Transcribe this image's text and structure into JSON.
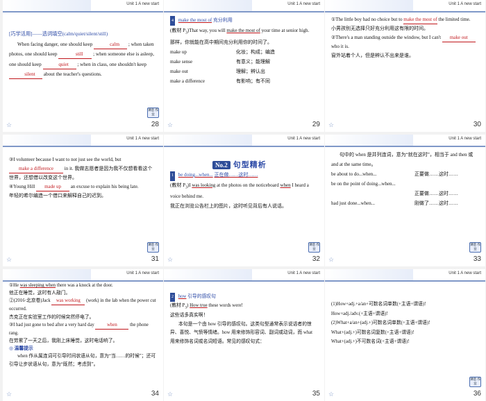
{
  "header_text": "Unit 1   A new start",
  "badge_text": "课后 作业",
  "slides": [
    {
      "page": "28",
      "title": "[巧学活用]——选词填空(calm/quiet/silent/still)",
      "p1": "When facing danger, one should keep",
      "a1": "calm",
      "p2": "; when taken photos, one should keep",
      "a2": "still",
      "p3": "; when someone else is asleep, one should keep",
      "a3": "quiet",
      "p4": "; when in class, one shouldn't keep",
      "a4": "silent",
      "p5": "about the teacher's questions."
    },
    {
      "page": "29",
      "num": "4",
      "phrase": "make the most of",
      "phrase_cn": "充分利用",
      "src_pre": "(教材 P",
      "src_sub": "3",
      "src_mid": ")That way, you will",
      "src_phrase": "make the most of",
      "src_post": "your time at senior high.",
      "translation": "那样，你就能在高中期间充分利用你的时间了。",
      "rows": [
        {
          "en": "make up",
          "cn": "化妆；构成；编造"
        },
        {
          "en": "make sense",
          "cn": "有意义；能理解"
        },
        {
          "en": "make out",
          "cn": "理解；辨认出"
        },
        {
          "en": "make a difference",
          "cn": "有影响；有不同"
        }
      ]
    },
    {
      "page": "30",
      "q1_num": "①",
      "q1_pre": "The little boy had no choice but to",
      "q1_ans": "make the most of",
      "q1_post": "the limited time.",
      "q1_cn": "小男孩别无选择只好充分利用这有限的时间。",
      "q2_num": "②",
      "q2_pre": "There's a man standing outside the window, but I can't",
      "q2_ans": "make out",
      "q2_post": "who it is.",
      "q2_cn": "窗外站着个人，但是辨认不出来是谁。"
    },
    {
      "page": "31",
      "q3_num": "③",
      "q3_pre": "I volunteer because I want to not just see the world, but",
      "q3_ans": "make a difference",
      "q3_post": "in it.",
      "q3_cn": "我做志愿者是因为我不仅想看看这个世界，还想借以改变这个世界。",
      "q4_num": "④",
      "q4_pre": "Young Hill",
      "q4_ans": "made up",
      "q4_post": "an excuse to explain his being late.",
      "q4_cn": "年轻的希尔编造一个借口来解释自己的迟到。"
    },
    {
      "page": "32",
      "no_label": "No.2",
      "section_title": "句型精析",
      "num": "1",
      "pattern": "be doing...when...",
      "pattern_cn": "正在做……这时……",
      "src_pre": "(教材 P",
      "src_sub": "3",
      "src_mid": ")I",
      "src_phrase1": "was looking",
      "src_mid2": "at the photos on the noticeboard",
      "src_phrase2": "when",
      "src_post": "I heard a voice behind me.",
      "translation": "我正在浏览公告栏上的图片，这时听见背后有人说话。"
    },
    {
      "page": "33",
      "intro": "句中的 when 是并列连词，意为“就在这时”，相当于 and then 或 and at the same time。",
      "rows": [
        {
          "en": "be about to do...when...",
          "cn": "正要做……这时……"
        },
        {
          "en": "be on the point of doing...when...",
          "cn": "正要做……这时……"
        },
        {
          "en": "had just done...when...",
          "cn": "刚做了……这时……"
        }
      ]
    },
    {
      "page": "34",
      "q1_num": "①",
      "q1_pre": "He",
      "q1_ans": "was sleeping when",
      "q1_post": "there was a knock at the door.",
      "q1_cn": "他正在睡觉，这时有人敲门。",
      "q2_num": "②",
      "q2_pre": "(2016·北京卷)Jack",
      "q2_ans": "was working",
      "q2_post": "(work) in the lab when the power cut occurred.",
      "q2_cn": "杰克正在实验室工作的时候突然停电了。",
      "q3_num": "③",
      "q3_pre": "I had just gone to bed after a very hard day",
      "q3_ans": "when",
      "q3_post": "the phone rang.",
      "q3_cn": "在劳累了一天之后，我刚上床睡觉，这时电话响了。",
      "tip_title": "温馨提示",
      "tip": "when 作从属连词可引导时间状语从句，意为“当……的时候”；还可引导让步状语从句，意为“既然；考虑到”。"
    },
    {
      "page": "35",
      "num": "2",
      "word": "how",
      "title": "引导的感叹句",
      "src_pre": "(教材 P",
      "src_sub": "3",
      "src_mid": ")",
      "src_phrase": "How true",
      "src_post": "these words were!",
      "translation": "这些话多真实啊！",
      "explain": "本句是一个由 how 引导的感叹句。这类句型通常表示说话者的惊异、喜悦、气愤等情绪。how 用来修饰形容词、副词或动词，而 what 用来修饰名词或名词短语。常见的感叹句式："
    },
    {
      "page": "36",
      "lines": [
        "(1)How+adj.+a/an+可数名词单数(+主语+谓语)!",
        "How+adj./adv.(+主语+谓语)!",
        "(2)What+a/an+(adj.+)可数名词单数(+主语+谓语)!",
        "What+(adj.+)可数名词复数(+主语+谓语)!",
        "What+(adj.+)不可数名词(+主语+谓语)!"
      ]
    }
  ]
}
